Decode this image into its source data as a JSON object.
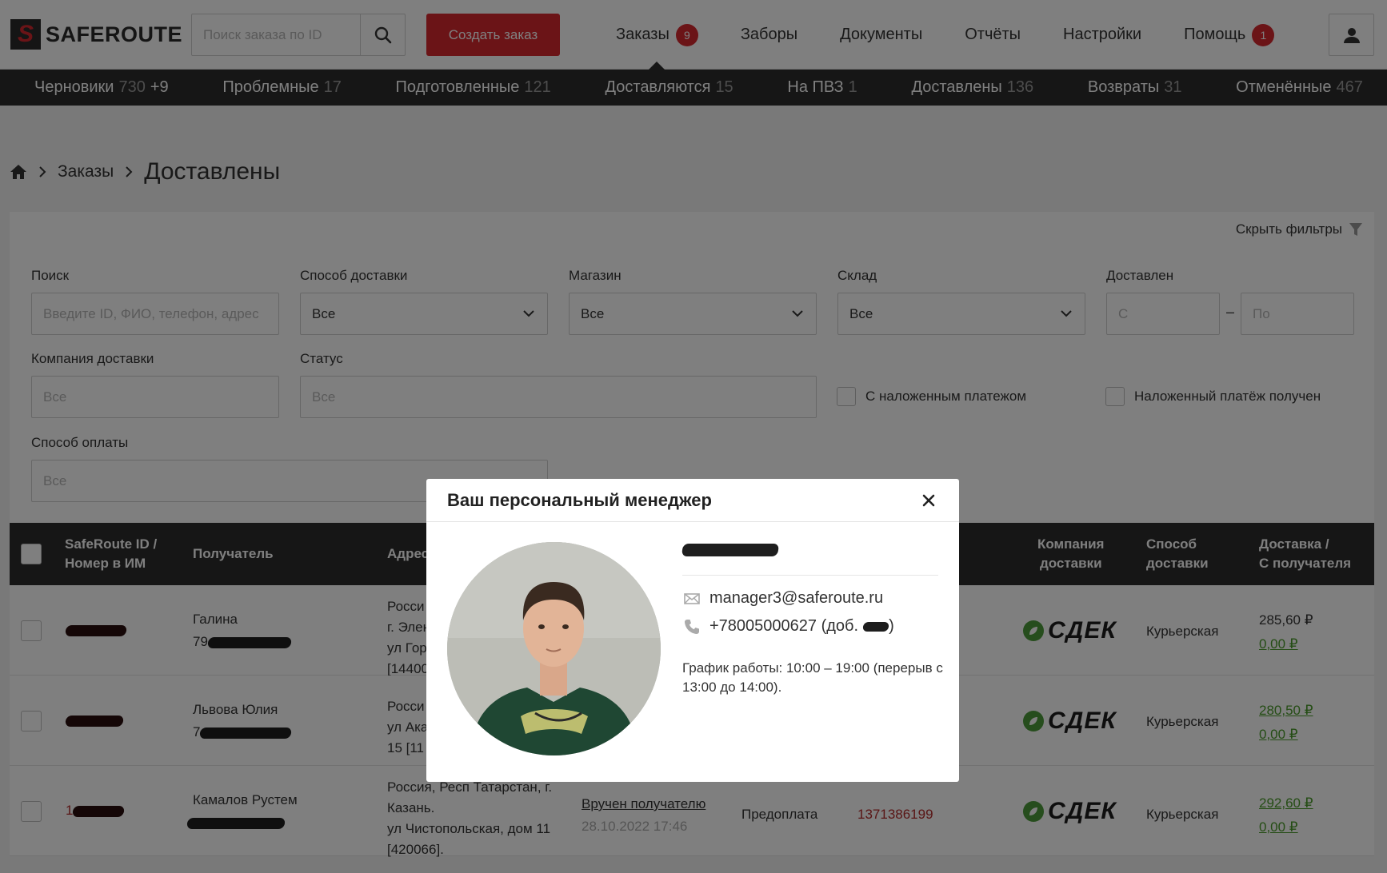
{
  "brand": {
    "name": "SAFEROUTE",
    "mark": "S",
    "accent": "#d7282f",
    "dark": "#2d2d2d"
  },
  "header": {
    "search_placeholder": "Поиск заказа по ID",
    "create_button": "Создать заказ",
    "nav": [
      {
        "label": "Заказы",
        "badge": "9"
      },
      {
        "label": "Заборы"
      },
      {
        "label": "Документы"
      },
      {
        "label": "Отчёты"
      },
      {
        "label": "Настройки"
      },
      {
        "label": "Помощь",
        "badge": "1"
      }
    ]
  },
  "status_tabs": [
    {
      "label": "Черновики",
      "count": "730",
      "extra": "+9"
    },
    {
      "label": "Проблемные",
      "count": "17"
    },
    {
      "label": "Подготовленные",
      "count": "121"
    },
    {
      "label": "Доставляются",
      "count": "15"
    },
    {
      "label": "На ПВЗ",
      "count": "1"
    },
    {
      "label": "Доставлены",
      "count": "136"
    },
    {
      "label": "Возвраты",
      "count": "31"
    },
    {
      "label": "Отменённые",
      "count": "467"
    }
  ],
  "breadcrumb": {
    "parent": "Заказы",
    "current": "Доставлены"
  },
  "filters": {
    "hide_label": "Скрыть фильтры",
    "search_label": "Поиск",
    "search_placeholder": "Введите ID, ФИО, телефон, адрес",
    "delivery_method_label": "Способ доставки",
    "delivery_method_value": "Все",
    "shop_label": "Магазин",
    "shop_value": "Все",
    "warehouse_label": "Склад",
    "warehouse_value": "Все",
    "delivered_label": "Доставлен",
    "from_placeholder": "С",
    "dash": "–",
    "to_placeholder": "По",
    "company_label": "Компания доставки",
    "company_placeholder": "Все",
    "status_label": "Статус",
    "status_placeholder": "Все",
    "cod_label": "С наложенным платежом",
    "cod_received_label": "Наложенный платёж получен",
    "payment_label": "Способ оплаты",
    "payment_placeholder": "Все"
  },
  "table": {
    "headers": {
      "id": [
        "SafeRoute ID /",
        "Номер в ИМ"
      ],
      "recipient": "Получатель",
      "address": "Адрес",
      "company": [
        "Компания",
        "доставки"
      ],
      "method": [
        "Способ",
        "доставки"
      ],
      "cost": [
        "Доставка /",
        "С получателя"
      ]
    },
    "rows": [
      {
        "recipient": "Галина",
        "phone_prefix": "79",
        "address": [
          "Росси",
          "г. Элен",
          "ул Гор",
          "[14400"
        ],
        "company": "СДЕК",
        "method": "Курьерская",
        "cost": "285,60 ₽",
        "cod": "0,00 ₽"
      },
      {
        "recipient": "Львова Юлия",
        "phone_prefix": "7",
        "address": [
          "Росси",
          "ул Ака",
          "15 [11"
        ],
        "company": "СДЕК",
        "method": "Курьерская",
        "cost": "280,50 ₽",
        "cod": "0,00 ₽"
      },
      {
        "id_prefix": "1",
        "recipient": "Камалов Рустем",
        "address": [
          "Россия, Респ Татарстан, г.",
          "Казань.",
          "ул Чистопольская, дом 11",
          "[420066]."
        ],
        "status": "Вручен получателю",
        "status_date": "28.10.2022 17:46",
        "payment": "Предоплата",
        "track": "1371386199",
        "company": "СДЕК",
        "method": "Курьерская",
        "cost": "292,60 ₽",
        "cod": "0,00 ₽"
      }
    ]
  },
  "modal": {
    "title": "Ваш персональный менеджер",
    "email": "manager3@saferoute.ru",
    "phone": "+78005000627 (доб.",
    "phone_close": ")",
    "hours": "График работы: 10:00 – 19:00 (перерыв с 13:00 до 14:00)."
  },
  "icons": {
    "search": "search-icon",
    "user": "user-icon",
    "home": "home-icon",
    "filter": "filter-icon",
    "close": "close-icon",
    "mail": "mail-icon",
    "phone": "phone-icon"
  }
}
